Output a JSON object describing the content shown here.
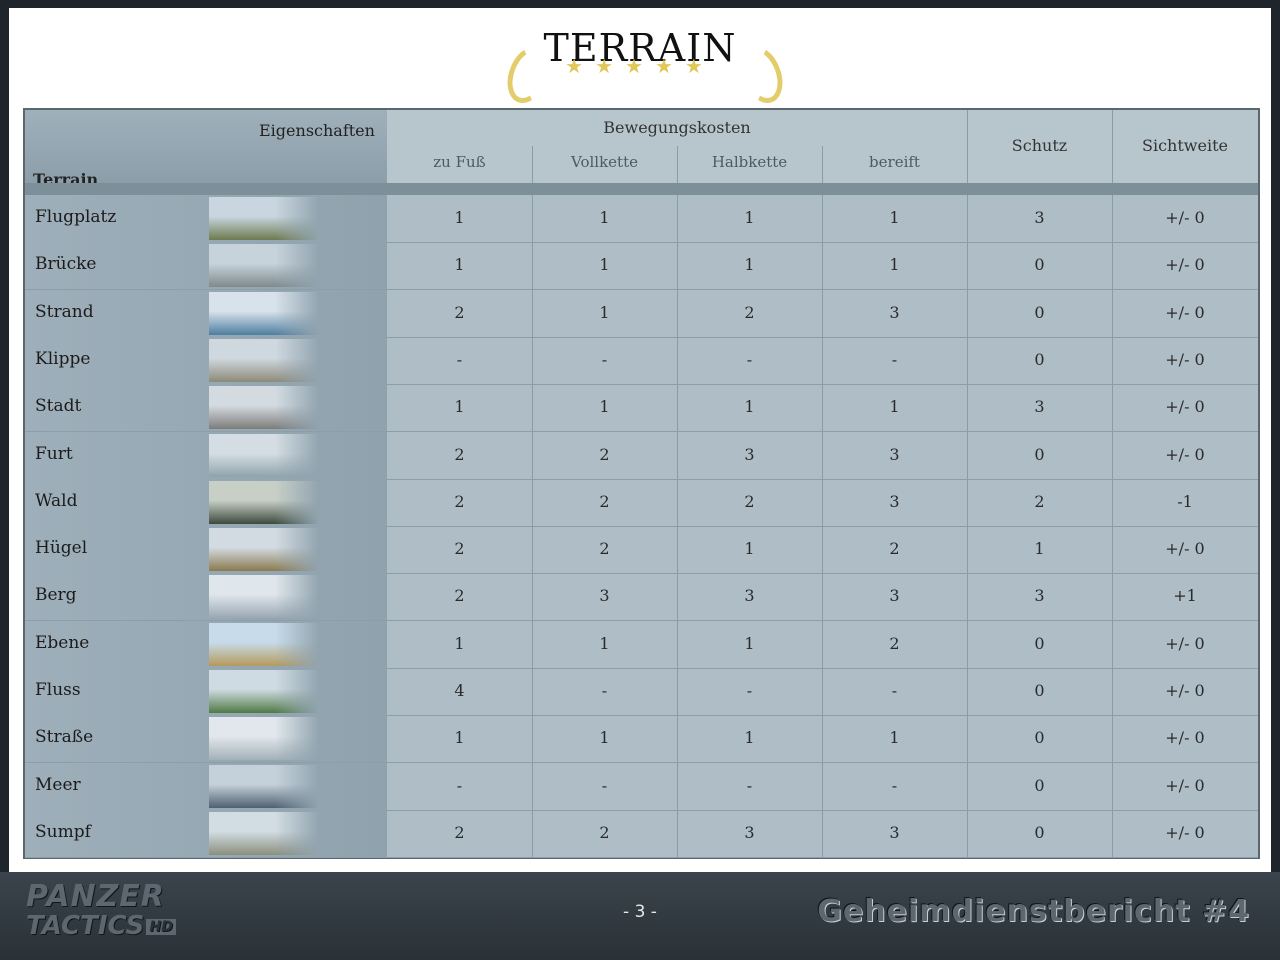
{
  "title": "TERRAIN",
  "stars": "★★★★★",
  "header": {
    "eigenschaften": "Eigenschaften",
    "terrain": "Terrain",
    "bewegungskosten": "Bewegungskosten",
    "zu_fuss": "zu Fuß",
    "vollkette": "Vollkette",
    "halbkette": "Halbkette",
    "bereift": "bereift",
    "schutz": "Schutz",
    "sichtweite": "Sichtweite"
  },
  "rows": [
    {
      "name": "Flugplatz",
      "zu_fuss": "1",
      "vollkette": "1",
      "halbkette": "1",
      "bereift": "1",
      "schutz": "3",
      "sicht": "+/- 0"
    },
    {
      "name": "Brücke",
      "zu_fuss": "1",
      "vollkette": "1",
      "halbkette": "1",
      "bereift": "1",
      "schutz": "0",
      "sicht": "+/- 0"
    },
    {
      "name": "Strand",
      "zu_fuss": "2",
      "vollkette": "1",
      "halbkette": "2",
      "bereift": "3",
      "schutz": "0",
      "sicht": "+/- 0"
    },
    {
      "name": "Klippe",
      "zu_fuss": "-",
      "vollkette": "-",
      "halbkette": "-",
      "bereift": "-",
      "schutz": "0",
      "sicht": "+/- 0"
    },
    {
      "name": "Stadt",
      "zu_fuss": "1",
      "vollkette": "1",
      "halbkette": "1",
      "bereift": "1",
      "schutz": "3",
      "sicht": "+/- 0"
    },
    {
      "name": "Furt",
      "zu_fuss": "2",
      "vollkette": "2",
      "halbkette": "3",
      "bereift": "3",
      "schutz": "0",
      "sicht": "+/- 0"
    },
    {
      "name": "Wald",
      "zu_fuss": "2",
      "vollkette": "2",
      "halbkette": "2",
      "bereift": "3",
      "schutz": "2",
      "sicht": "-1"
    },
    {
      "name": "Hügel",
      "zu_fuss": "2",
      "vollkette": "2",
      "halbkette": "1",
      "bereift": "2",
      "schutz": "1",
      "sicht": "+/- 0"
    },
    {
      "name": "Berg",
      "zu_fuss": "2",
      "vollkette": "3",
      "halbkette": "3",
      "bereift": "3",
      "schutz": "3",
      "sicht": "+1"
    },
    {
      "name": "Ebene",
      "zu_fuss": "1",
      "vollkette": "1",
      "halbkette": "1",
      "bereift": "2",
      "schutz": "0",
      "sicht": "+/- 0"
    },
    {
      "name": "Fluss",
      "zu_fuss": "4",
      "vollkette": "-",
      "halbkette": "-",
      "bereift": "-",
      "schutz": "0",
      "sicht": "+/- 0"
    },
    {
      "name": "Straße",
      "zu_fuss": "1",
      "vollkette": "1",
      "halbkette": "1",
      "bereift": "1",
      "schutz": "0",
      "sicht": "+/- 0"
    },
    {
      "name": "Meer",
      "zu_fuss": "-",
      "vollkette": "-",
      "halbkette": "-",
      "bereift": "-",
      "schutz": "0",
      "sicht": "+/- 0"
    },
    {
      "name": "Sumpf",
      "zu_fuss": "2",
      "vollkette": "2",
      "halbkette": "3",
      "bereift": "3",
      "schutz": "0",
      "sicht": "+/- 0"
    }
  ],
  "thumb_colors": [
    [
      "#c9d6df",
      "#6d7a4f"
    ],
    [
      "#c7d3db",
      "#7f8a8d"
    ],
    [
      "#d7e2ea",
      "#4d7ea0"
    ],
    [
      "#cfd8df",
      "#8c8a78"
    ],
    [
      "#d3dbe1",
      "#7d7c7a"
    ],
    [
      "#d4dde3",
      "#8fa3ab"
    ],
    [
      "#c7cfc7",
      "#3d4a3b"
    ],
    [
      "#d3dbe2",
      "#8a7a4f"
    ],
    [
      "#dfe6ec",
      "#9aa7b2"
    ],
    [
      "#c7dbea",
      "#b49a5a"
    ],
    [
      "#cfdbe2",
      "#4f7a45"
    ],
    [
      "#e1e7ec",
      "#a3b0b8"
    ],
    [
      "#c5d1da",
      "#4f6070"
    ],
    [
      "#d2dce3",
      "#8a8f7d"
    ]
  ],
  "footer": {
    "logo_line1": "PANZER",
    "logo_line2": "TACTICS",
    "logo_hd": "HD",
    "page": "- 3 -",
    "report": "Geheimdienstbericht #4"
  }
}
